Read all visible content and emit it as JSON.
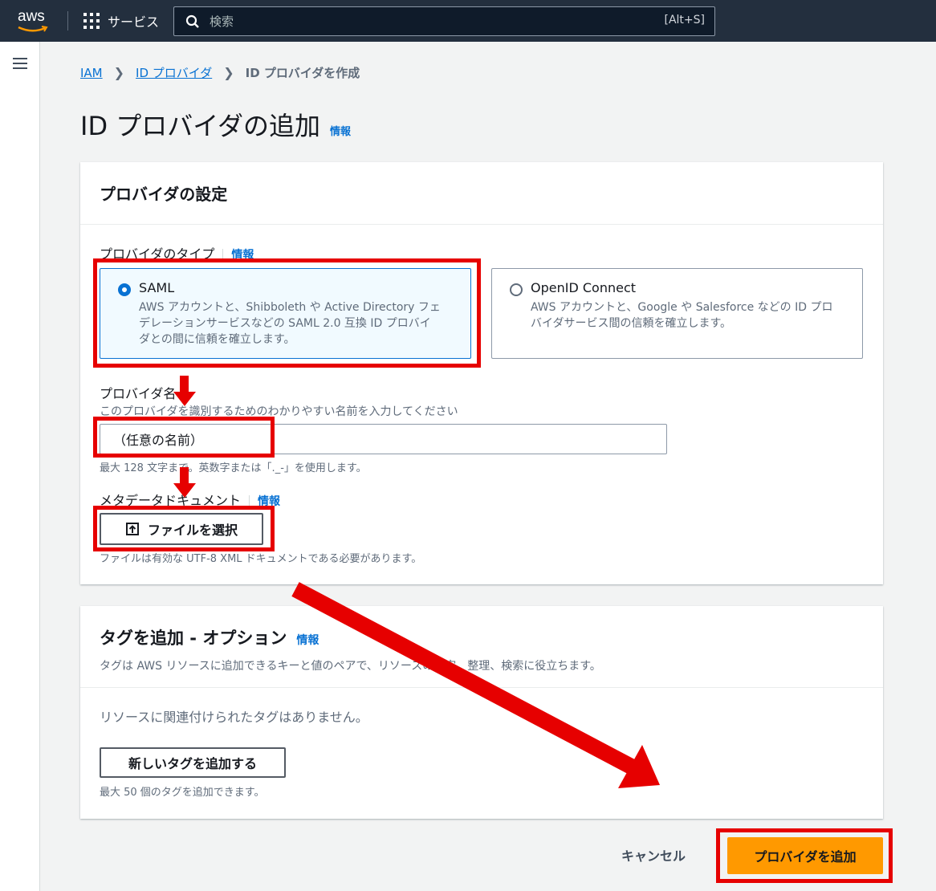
{
  "nav": {
    "logo": "aws",
    "services_label": "サービス",
    "search_placeholder": "検索",
    "search_shortcut": "[Alt+S]"
  },
  "breadcrumb": {
    "items": [
      "IAM",
      "ID プロバイダ"
    ],
    "current": "ID プロバイダを作成"
  },
  "page": {
    "title": "ID プロバイダの追加",
    "info": "情報"
  },
  "provider_panel": {
    "title": "プロバイダの設定",
    "type_label": "プロバイダのタイプ",
    "type_info": "情報",
    "options": [
      {
        "title": "SAML",
        "desc_lines": [
          "AWS アカウントと、Shibboleth や Active Directory フェ",
          "デレーションサービスなどの SAML 2.0 互換 ID プロバイ",
          "ダとの間に信頼を確立します。"
        ],
        "selected": true
      },
      {
        "title": "OpenID Connect",
        "desc_lines": [
          "AWS アカウントと、Google や Salesforce などの ID プロ",
          "バイダサービス間の信頼を確立します。"
        ],
        "selected": false
      }
    ],
    "name_label": "プロバイダ名",
    "name_desc": "このプロバイダを識別するためのわかりやすい名前を入力してください",
    "name_value": "（任意の名前）",
    "name_hint": "最大 128 文字まで。英数字または「._-」を使用します。",
    "metadata_label": "メタデータドキュメント",
    "metadata_info": "情報",
    "choose_file": "ファイルを選択",
    "metadata_hint": "ファイルは有効な UTF-8 XML ドキュメントである必要があります。"
  },
  "tags_panel": {
    "title": "タグを追加 - オプション",
    "info": "情報",
    "desc": "タグは AWS リソースに追加できるキーと値のペアで、リソースの特定、整理、検索に役立ちます。",
    "empty": "リソースに関連付けられたタグはありません。",
    "add_tag": "新しいタグを追加する",
    "hint": "最大 50 個のタグを追加できます。"
  },
  "footer": {
    "cancel": "キャンセル",
    "submit": "プロバイダを追加"
  },
  "colors": {
    "nav_bg": "#232f3e",
    "link": "#0972d3",
    "primary": "#ff9900",
    "annotation": "#e60000"
  }
}
